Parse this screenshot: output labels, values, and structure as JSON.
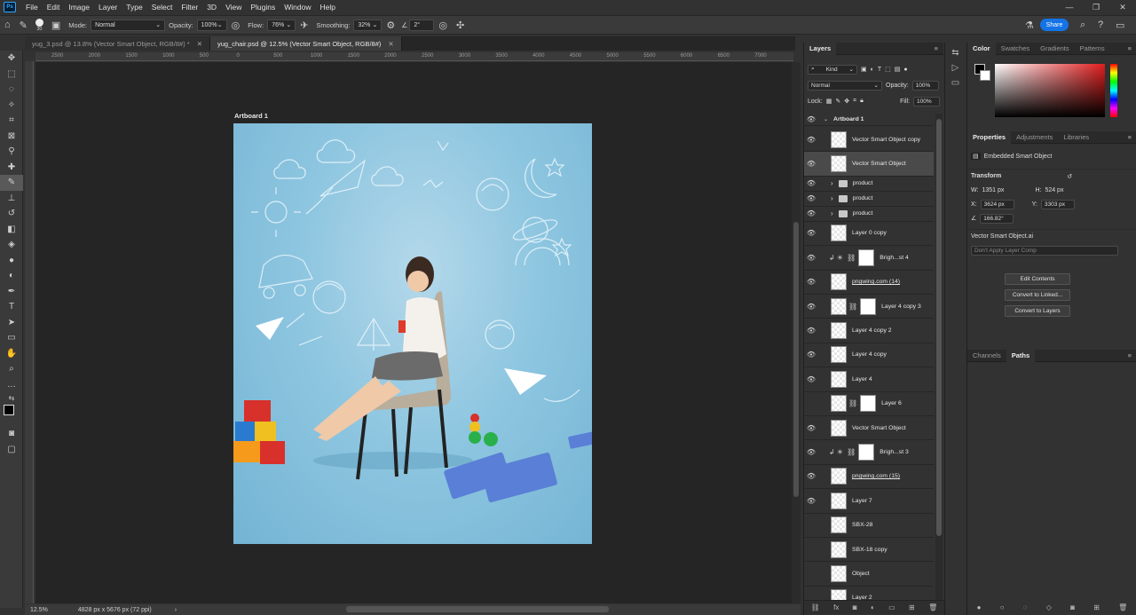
{
  "menu": {
    "logo": "Ps",
    "items": [
      "File",
      "Edit",
      "Image",
      "Layer",
      "Type",
      "Select",
      "Filter",
      "3D",
      "View",
      "Plugins",
      "Window",
      "Help"
    ],
    "window_controls": [
      "—",
      "❐",
      "✕"
    ]
  },
  "options": {
    "brush_size": "30",
    "mode_label": "Mode:",
    "mode_value": "Normal",
    "opacity_label": "Opacity:",
    "opacity_value": "100%",
    "flow_label": "Flow:",
    "flow_value": "76%",
    "smoothing_label": "Smoothing:",
    "smoothing_value": "32%",
    "angle_value": "2°",
    "share_label": "Share"
  },
  "doc_tabs": [
    {
      "label": "yug_3.psd @ 13.8% (Vector Smart Object, RGB/8#) *",
      "active": false
    },
    {
      "label": "yug_chair.psd @ 12.5% (Vector Smart Object, RGB/8#)",
      "active": true
    }
  ],
  "ruler_marks": [
    "2500",
    "2000",
    "1500",
    "1000",
    "500",
    "0",
    "500",
    "1000",
    "1500",
    "2000",
    "2500",
    "3000",
    "3500",
    "4000",
    "4500",
    "5000",
    "5500",
    "6000",
    "6500",
    "7000"
  ],
  "artboard_label": "Artboard 1",
  "status": {
    "zoom": "12.5%",
    "doc_size": "4828 px x 5676 px (72 ppi)"
  },
  "layers_panel": {
    "title": "Layers",
    "kind_label": "Kind",
    "blend_mode": "Normal",
    "opacity_label": "Opacity:",
    "opacity_value": "100%",
    "lock_label": "Lock:",
    "fill_label": "Fill:",
    "fill_value": "100%",
    "artboard_name": "Artboard 1",
    "layers": [
      {
        "name": "Vector Smart Object copy",
        "visible": true,
        "kind": "smart",
        "selected": false
      },
      {
        "name": "Vector Smart Object",
        "visible": true,
        "kind": "smart",
        "selected": true
      },
      {
        "name": "product",
        "visible": true,
        "kind": "folder",
        "selected": false
      },
      {
        "name": "product",
        "visible": true,
        "kind": "folder",
        "selected": false
      },
      {
        "name": "product",
        "visible": true,
        "kind": "folder",
        "selected": false
      },
      {
        "name": "Layer 0 copy",
        "visible": true,
        "kind": "smart",
        "selected": false
      },
      {
        "name": "Brigh...st 4",
        "visible": true,
        "kind": "adjust",
        "selected": false
      },
      {
        "name": "pngwing.com (14)",
        "visible": true,
        "kind": "smart",
        "selected": false
      },
      {
        "name": "Layer 4 copy 3",
        "visible": true,
        "kind": "masked",
        "selected": false
      },
      {
        "name": "Layer 4 copy 2",
        "visible": true,
        "kind": "pixel",
        "selected": false
      },
      {
        "name": "Layer 4 copy",
        "visible": true,
        "kind": "pixel",
        "selected": false
      },
      {
        "name": "Layer 4",
        "visible": true,
        "kind": "pixel",
        "selected": false
      },
      {
        "name": "Layer 6",
        "visible": false,
        "kind": "masked",
        "selected": false
      },
      {
        "name": "Vector Smart Object",
        "visible": true,
        "kind": "smart",
        "selected": false
      },
      {
        "name": "Brigh...st 3",
        "visible": true,
        "kind": "adjust",
        "selected": false
      },
      {
        "name": "pngwing.com (15)",
        "visible": true,
        "kind": "smart",
        "selected": false
      },
      {
        "name": "Layer 7",
        "visible": true,
        "kind": "pixel",
        "selected": false
      },
      {
        "name": "SBX-28",
        "visible": false,
        "kind": "smart",
        "selected": false
      },
      {
        "name": "SBX-18 copy",
        "visible": false,
        "kind": "smart",
        "selected": false
      },
      {
        "name": "Object",
        "visible": false,
        "kind": "pixel",
        "selected": false
      },
      {
        "name": "Layer 2",
        "visible": false,
        "kind": "pixel",
        "selected": false
      }
    ]
  },
  "color_panel": {
    "tabs": [
      "Color",
      "Swatches",
      "Gradients",
      "Patterns"
    ]
  },
  "properties_panel": {
    "tabs": [
      "Properties",
      "Adjustments",
      "Libraries"
    ],
    "type_label": "Embedded Smart Object",
    "transform_label": "Transform",
    "w_label": "W:",
    "w_value": "1351 px",
    "h_label": "H:",
    "h_value": "524 px",
    "x_label": "X:",
    "x_value": "3624 px",
    "y_label": "Y:",
    "y_value": "3303 px",
    "angle_value": "166.82°",
    "file_name": "Vector Smart Object.ai",
    "layer_comp": "Don't Apply Layer Comp",
    "buttons": [
      "Edit Contents",
      "Convert to Linked...",
      "Convert to Layers"
    ]
  },
  "paths_panel": {
    "tabs": [
      "Channels",
      "Paths"
    ]
  }
}
